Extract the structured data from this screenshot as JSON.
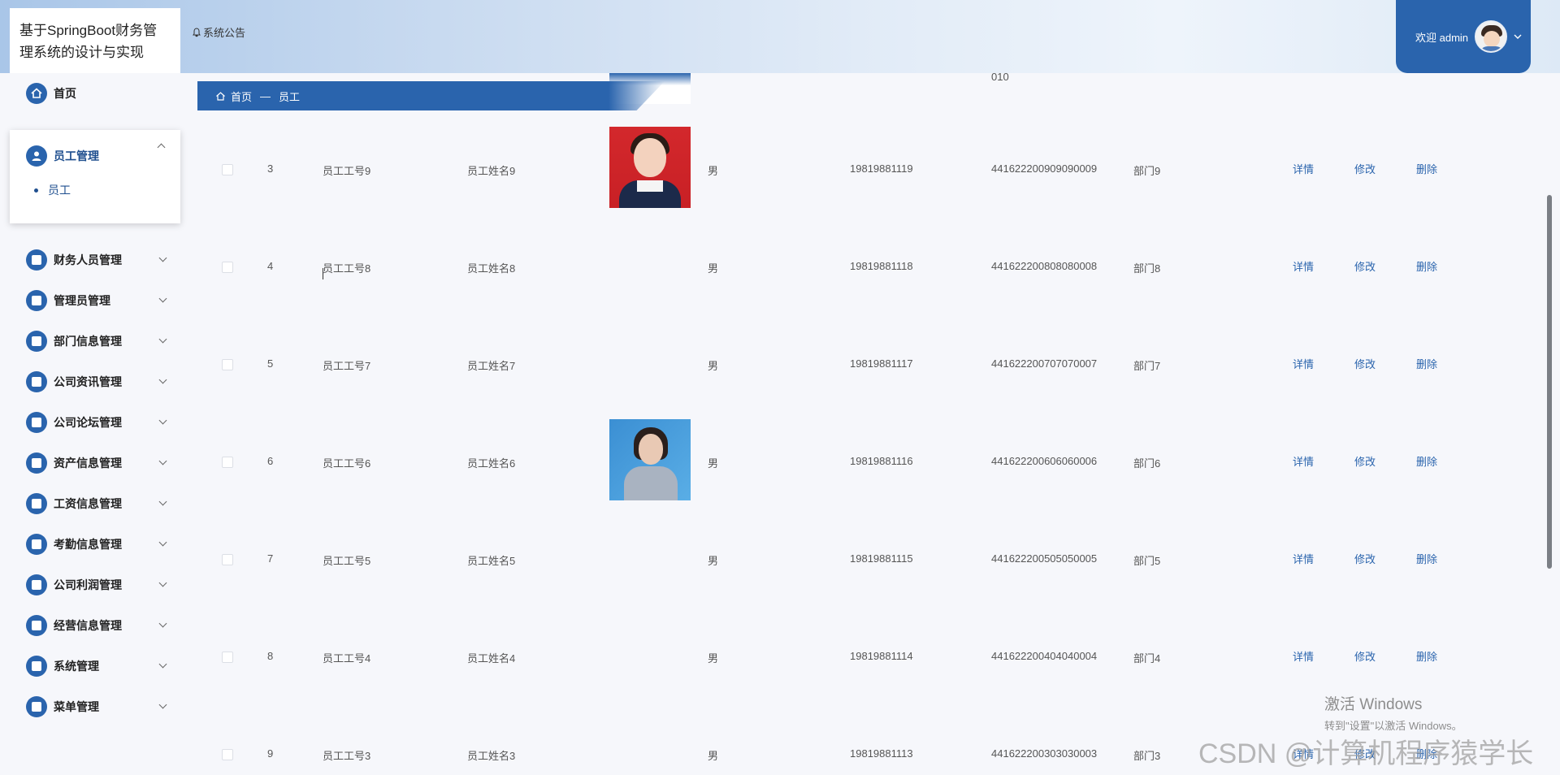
{
  "header": {
    "title": "基于SpringBoot财务管理系统的设计与实现",
    "title_line1": "基于SpringBoot财务管",
    "title_line2": "理系统的设计与实现",
    "notice_icon": "bell-icon",
    "notice_label": "系统公告",
    "user_greeting": "欢迎 admin",
    "brand_color": "#2a64ad"
  },
  "sidebar": {
    "home": "首页",
    "expanded_group": "员工管理",
    "expanded_sub": "员工",
    "items": [
      "财务人员管理",
      "管理员管理",
      "部门信息管理",
      "公司资讯管理",
      "公司论坛管理",
      "资产信息管理",
      "工资信息管理",
      "考勤信息管理",
      "公司利润管理",
      "经营信息管理",
      "系统管理",
      "菜单管理"
    ]
  },
  "breadcrumb": {
    "home": "首页",
    "separator": "—",
    "current": "员工"
  },
  "partial_top_text": "010",
  "table": {
    "actions": {
      "detail": "详情",
      "edit": "修改",
      "delete": "删除"
    },
    "rows": [
      {
        "index": "3",
        "emp_no": "员工工号9",
        "name": "员工姓名9",
        "photo": "red-bg-girl",
        "gender": "男",
        "phone": "19819881119",
        "id_card": "441622200909090009",
        "dept": "部门9"
      },
      {
        "index": "4",
        "emp_no": "员工工号8",
        "name": "员工姓名8",
        "photo": "",
        "gender": "男",
        "phone": "19819881118",
        "id_card": "441622200808080008",
        "dept": "部门8"
      },
      {
        "index": "5",
        "emp_no": "员工工号7",
        "name": "员工姓名7",
        "photo": "",
        "gender": "男",
        "phone": "19819881117",
        "id_card": "441622200707070007",
        "dept": "部门7"
      },
      {
        "index": "6",
        "emp_no": "员工工号6",
        "name": "员工姓名6",
        "photo": "blue-bg-woman",
        "gender": "男",
        "phone": "19819881116",
        "id_card": "441622200606060006",
        "dept": "部门6"
      },
      {
        "index": "7",
        "emp_no": "员工工号5",
        "name": "员工姓名5",
        "photo": "",
        "gender": "男",
        "phone": "19819881115",
        "id_card": "441622200505050005",
        "dept": "部门5"
      },
      {
        "index": "8",
        "emp_no": "员工工号4",
        "name": "员工姓名4",
        "photo": "",
        "gender": "男",
        "phone": "19819881114",
        "id_card": "441622200404040004",
        "dept": "部门4"
      },
      {
        "index": "9",
        "emp_no": "员工工号3",
        "name": "员工姓名3",
        "photo": "",
        "gender": "男",
        "phone": "19819881113",
        "id_card": "441622200303030003",
        "dept": "部门3"
      }
    ]
  },
  "overlay": {
    "activate_title": "激活 Windows",
    "activate_hint": "转到\"设置\"以激活 Windows。",
    "watermark": "CSDN @计算机程序猿学长"
  }
}
